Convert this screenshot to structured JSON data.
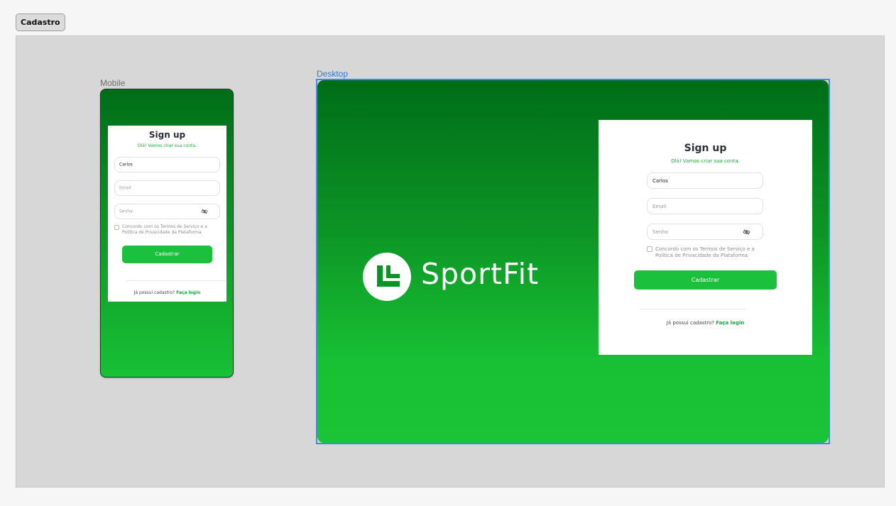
{
  "section": {
    "label": "Cadastro"
  },
  "frames": {
    "mobile_label": "Mobile",
    "desktop_label": "Desktop"
  },
  "brand": {
    "name": "SportFit",
    "logo_icon": "sportfit-logo-icon"
  },
  "colors": {
    "accent": "#1bc13c",
    "gradient_top": "#006d18",
    "gradient_bottom": "#1ac436",
    "selection": "#3b8cf0"
  },
  "signup": {
    "title": "Sign up",
    "subtitle": "Olá! Vamos criar sua conta.",
    "name_value": "Carlos",
    "email_placeholder": "Email",
    "password_placeholder": "Senha",
    "password_toggle_icon": "eye-off-icon",
    "terms_line1": "Concordo com os Termos de Serviço e a",
    "terms_line2": "Política de Privacidade da Plataforma",
    "submit_label": "Cadastrar",
    "login_prompt": "Já possui cadastro?",
    "login_link": "Faça login"
  }
}
